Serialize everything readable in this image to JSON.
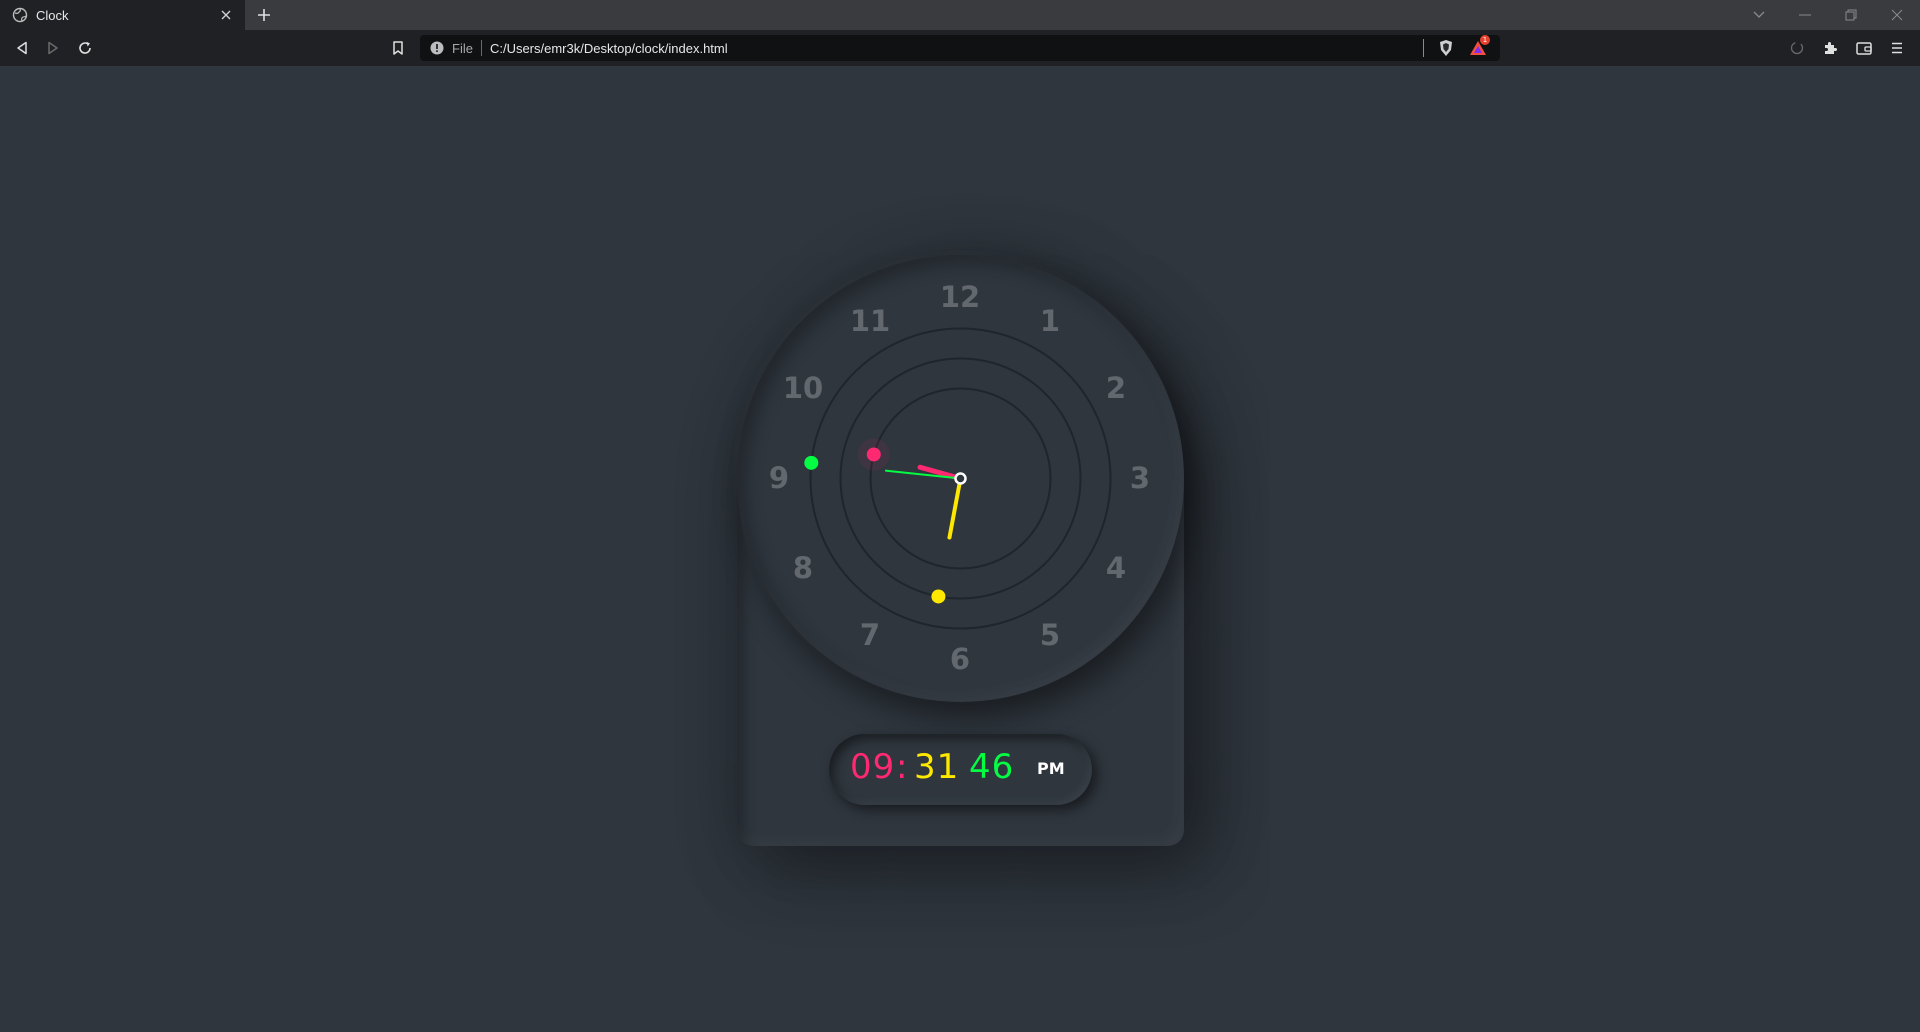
{
  "browser": {
    "tab_title": "Clock",
    "url_scheme_label": "File",
    "url": "C:/Users/emr3k/Desktop/clock/index.html",
    "shields_badge": "1"
  },
  "clock": {
    "numbers": [
      "12",
      "1",
      "2",
      "3",
      "4",
      "5",
      "6",
      "7",
      "8",
      "9",
      "10",
      "11"
    ],
    "digital": {
      "hours": "09",
      "separator": ":",
      "minutes": "31",
      "seconds": "46",
      "ampm": "PM"
    },
    "colors": {
      "hour": "#ff2972",
      "minute": "#fee800",
      "second": "#04fc43",
      "background": "#2f363e"
    },
    "time": {
      "hours": 21,
      "minutes": 31,
      "seconds": 46
    }
  }
}
